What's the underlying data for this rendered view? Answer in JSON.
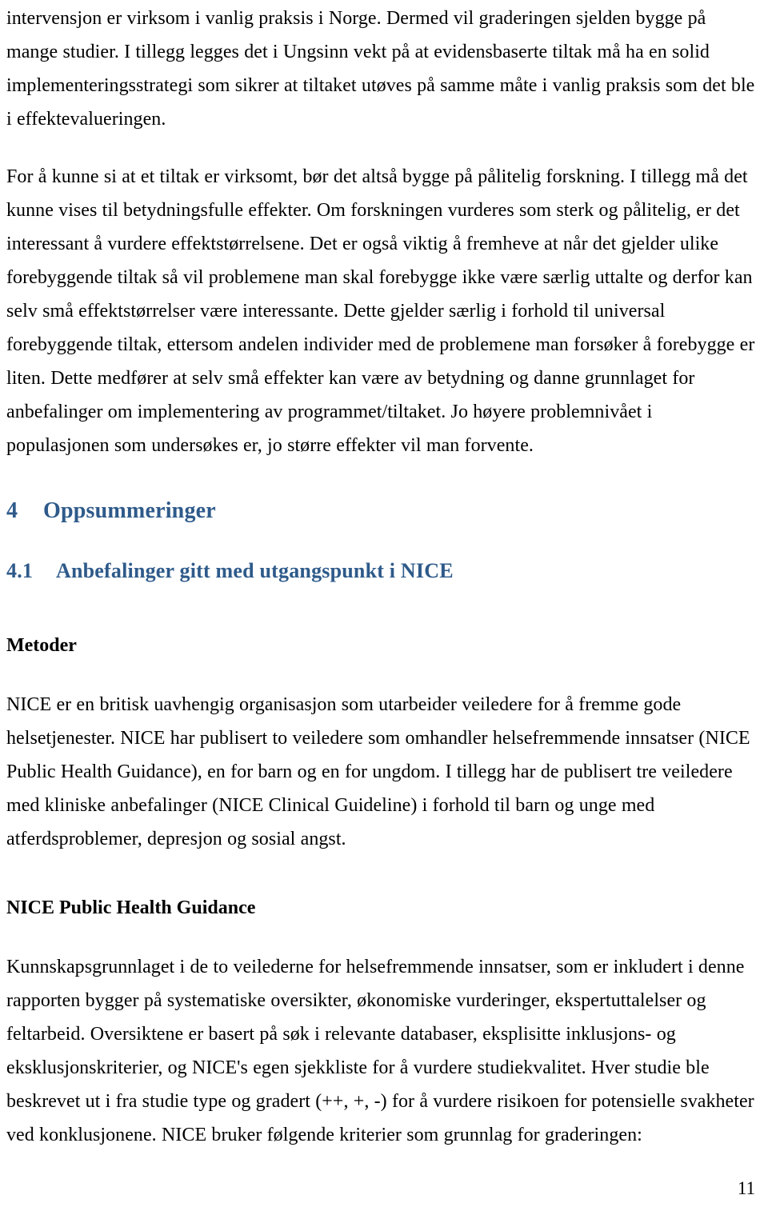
{
  "document": {
    "language": "no",
    "page_number": "11",
    "heading_color": "#2e5a8a",
    "body_color": "#000000",
    "background_color": "#ffffff"
  },
  "content": {
    "paragraph_1": "intervensjon er virksom i vanlig praksis i Norge. Dermed vil graderingen sjelden bygge på mange studier. I tillegg legges det i Ungsinn vekt på at evidensbaserte tiltak må ha en solid implementeringsstrategi som sikrer at tiltaket utøves på samme måte i vanlig praksis som det ble i effektevalueringen.",
    "paragraph_2": "For å kunne si at et tiltak er virksomt, bør det altså bygge på pålitelig forskning. I tillegg må det kunne vises til betydningsfulle effekter. Om forskningen vurderes som sterk og pålitelig, er det interessant å vurdere effektstørrelsene. Det er også viktig å fremheve at når det gjelder ulike forebyggende tiltak så vil problemene man skal forebygge ikke være særlig uttalte og derfor kan selv små effektstørrelser være interessante. Dette gjelder særlig i forhold til universal forebyggende tiltak, ettersom andelen individer med de problemene man forsøker å forebygge er liten. Dette medfører at selv små effekter kan være av betydning og danne grunnlaget for anbefalinger om implementering av programmet/tiltaket. Jo høyere problemnivået i populasjonen som undersøkes er, jo større effekter vil man forvente.",
    "chapter_heading": {
      "number": "4",
      "title": "Oppsummeringer"
    },
    "section_heading": {
      "number": "4.1",
      "title": "Anbefalinger gitt med utgangspunkt i NICE"
    },
    "subheading_metoder": "Metoder",
    "paragraph_3": "NICE er en britisk uavhengig organisasjon som utarbeider veiledere for å fremme gode helsetjenester. NICE har publisert to veiledere som omhandler helsefremmende innsatser (NICE Public Health Guidance), en for barn og en for ungdom. I tillegg har de publisert tre veiledere med kliniske anbefalinger (NICE Clinical Guideline) i forhold til barn og unge med atferdsproblemer, depresjon og sosial angst.",
    "subheading_guidance": "NICE Public Health Guidance",
    "paragraph_4": "Kunnskapsgrunnlaget i de to veilederne for helsefremmende innsatser, som er inkludert i denne rapporten bygger på systematiske oversikter, økonomiske vurderinger, ekspertuttalelser og feltarbeid. Oversiktene er basert på søk i relevante databaser, eksplisitte inklusjons- og eksklusjonskriterier, og NICE's egen sjekkliste for å vurdere studiekvalitet. Hver studie ble beskrevet ut i fra studie type og gradert (++, +, -) for å vurdere risikoen for potensielle svakheter ved konklusjonene. NICE bruker følgende kriterier som grunnlag for graderingen:"
  }
}
